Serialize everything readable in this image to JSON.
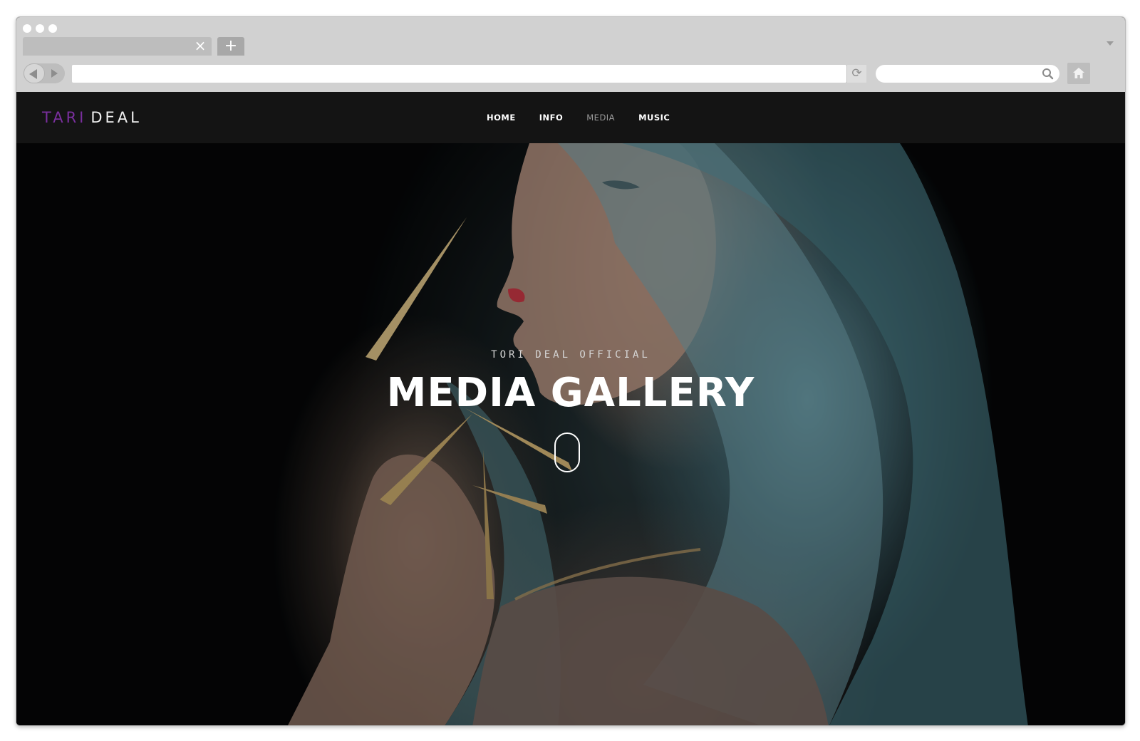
{
  "browser": {
    "tab_close_glyph": "×",
    "new_tab_glyph": "+",
    "address_value": "",
    "reload_glyph": "⟳",
    "search_value": ""
  },
  "site": {
    "logo": {
      "first": "TARI",
      "last": "DEAL"
    },
    "menu": [
      {
        "label": "HOME",
        "active": false
      },
      {
        "label": "INFO",
        "active": false
      },
      {
        "label": "MEDIA",
        "active": true
      },
      {
        "label": "MUSIC",
        "active": false
      }
    ],
    "hero": {
      "subtitle": "TORI DEAL OFFICIAL",
      "title": "MEDIA GALLERY",
      "scroll_indicator": "mouse-scroll-icon"
    }
  },
  "colors": {
    "logo_accent": "#7a2f9e",
    "header_bg": "#141414",
    "menu_active": "#9a9a9a",
    "chrome_bg": "#d1d1d1"
  }
}
